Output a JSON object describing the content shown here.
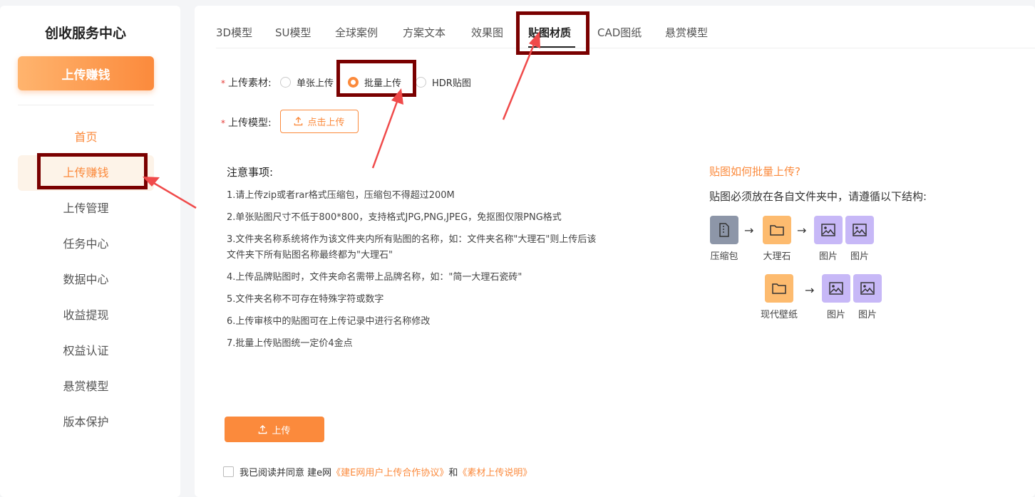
{
  "sidebar": {
    "title": "创收服务中心",
    "upload_button": "上传赚钱",
    "items": [
      {
        "label": "首页"
      },
      {
        "label": "上传赚钱"
      },
      {
        "label": "上传管理"
      },
      {
        "label": "任务中心"
      },
      {
        "label": "数据中心"
      },
      {
        "label": "收益提现"
      },
      {
        "label": "权益认证"
      },
      {
        "label": "悬赏模型"
      },
      {
        "label": "版本保护"
      }
    ]
  },
  "tabs": [
    {
      "label": "3D模型"
    },
    {
      "label": "SU模型"
    },
    {
      "label": "全球案例"
    },
    {
      "label": "方案文本"
    },
    {
      "label": "效果图"
    },
    {
      "label": "贴图材质",
      "active": true
    },
    {
      "label": "CAD图纸"
    },
    {
      "label": "悬赏模型"
    }
  ],
  "form": {
    "material_label": "上传素材:",
    "radios": [
      {
        "label": "单张上传",
        "checked": false
      },
      {
        "label": "批量上传",
        "checked": true
      },
      {
        "label": "HDR贴图",
        "checked": false
      }
    ],
    "model_label": "上传模型:",
    "click_upload": "点击上传"
  },
  "notes": {
    "title": "注意事项:",
    "items": [
      "1.请上传zip或者rar格式压缩包，压缩包不得超过200M",
      "2.单张贴图尺寸不低于800*800，支持格式JPG,PNG,JPEG，免抠图仅限PNG格式",
      "3.文件夹名称系统将作为该文件夹内所有贴图的名称，如：文件夹名称\"大理石\"则上传后该文件夹下所有贴图名称最终都为\"大理石\"",
      "4.上传品牌贴图时，文件夹命名需带上品牌名称，如：\"简一大理石瓷砖\"",
      "5.文件夹名称不可存在特殊字符或数字",
      "6.上传审核中的贴图可在上传记录中进行名称修改",
      "7.批量上传贴图统一定价4金点"
    ]
  },
  "guide": {
    "title": "贴图如何批量上传?",
    "desc": "贴图必须放在各自文件夹中，请遵循以下结构:",
    "zip_caption": "压缩包",
    "folder1_caption": "大理石",
    "folder2_caption": "现代壁纸",
    "image_caption": "图片",
    "arrow": "→"
  },
  "footer": {
    "upload_button": "上传",
    "agree_prefix": "我已阅读并同意 建e网",
    "agreement_link": "《建E网用户上传合作协议》",
    "and": "和",
    "instruction_link": "《素材上传说明》"
  },
  "colors": {
    "accent": "#fb8a3c",
    "highlight_box": "#7a0000",
    "annotation_arrow": "#f04a4a"
  }
}
